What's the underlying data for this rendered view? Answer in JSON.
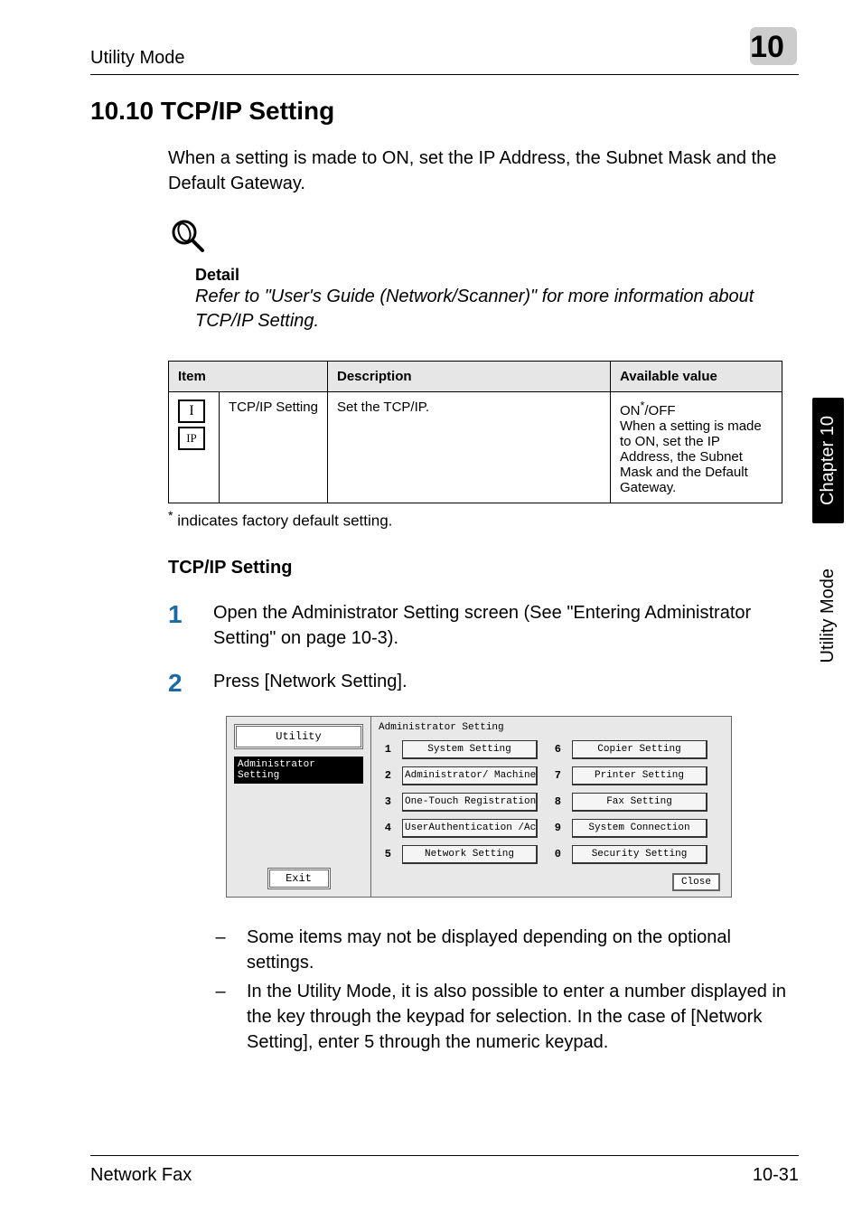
{
  "header": {
    "section": "Utility Mode",
    "chapter_num": "10"
  },
  "heading": "10.10  TCP/IP Setting",
  "intro": "When a setting is made to ON, set the IP Address, the Subnet Mask and the Default Gateway.",
  "detail": {
    "title": "Detail",
    "body": "Refer to \"User's Guide (Network/Scanner)\" for more information about TCP/IP Setting."
  },
  "table": {
    "head": {
      "item": "Item",
      "desc": "Description",
      "avail": "Available value"
    },
    "row": {
      "icon1": "I",
      "icon2": "IP",
      "name": "TCP/IP Setting",
      "desc": "Set the TCP/IP.",
      "avail": "ON*/OFF\nWhen a setting is made to ON, set the IP Address, the Subnet Mask and the Default Gateway.",
      "avail_line1": "ON",
      "avail_star": "*",
      "avail_line1b": "/OFF",
      "avail_line2": "When a setting is made to ON, set the IP Address, the Subnet Mask and the Default Gateway."
    }
  },
  "footnote": "indicates factory default setting.",
  "footnote_star": "*",
  "sub_heading": "TCP/IP Setting",
  "steps": {
    "s1_num": "1",
    "s1": "Open the Administrator Setting screen (See \"Entering Administrator Setting\" on page 10-3).",
    "s2_num": "2",
    "s2": "Press [Network Setting]."
  },
  "screenshot": {
    "left": {
      "utility": "Utility",
      "selected": "Administrator Setting",
      "exit": "Exit"
    },
    "header": "Administrator Setting",
    "items_left": [
      {
        "n": "1",
        "label": "System Setting"
      },
      {
        "n": "2",
        "label": "Administrator/ Machine Setting"
      },
      {
        "n": "3",
        "label": "One-Touch Registration"
      },
      {
        "n": "4",
        "label": "UserAuthentication /Account Track"
      },
      {
        "n": "5",
        "label": "Network Setting"
      }
    ],
    "items_right": [
      {
        "n": "6",
        "label": "Copier Setting"
      },
      {
        "n": "7",
        "label": "Printer Setting"
      },
      {
        "n": "8",
        "label": "Fax Setting"
      },
      {
        "n": "9",
        "label": "System Connection"
      },
      {
        "n": "0",
        "label": "Security Setting"
      }
    ],
    "close": "Close"
  },
  "notes": {
    "n1": "Some items may not be displayed depending on the optional settings.",
    "n2": "In the Utility Mode, it is also possible to enter a number displayed in the key through the keypad for selection. In the case of [Network Setting], enter 5 through the numeric keypad."
  },
  "side": {
    "chapter": "Chapter 10",
    "mode": "Utility Mode"
  },
  "footer": {
    "left": "Network Fax",
    "right": "10-31"
  }
}
